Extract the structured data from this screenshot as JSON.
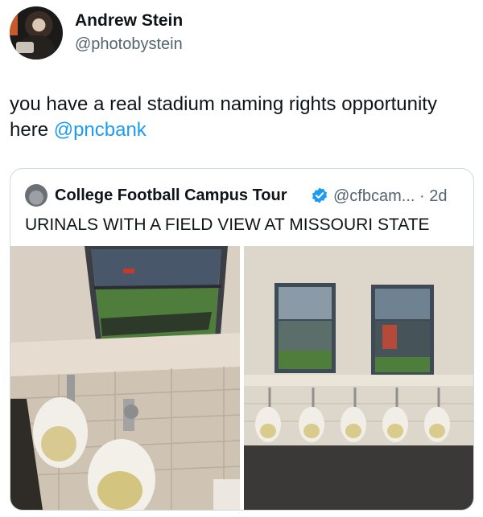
{
  "author": {
    "display_name": "Andrew Stein",
    "handle": "@photobystein"
  },
  "tweet": {
    "text": "you have a real stadium naming rights opportunity here ",
    "mention": "@pncbank"
  },
  "quote": {
    "display_name": "College Football Campus Tour",
    "verified_icon": "verified-badge-icon",
    "meta": "@cfbcam... · 2d",
    "text": "URINALS WITH A FIELD VIEW AT MISSOURI STATE",
    "images": [
      "urinal-field-window-photo-1",
      "urinal-field-window-photo-2"
    ]
  },
  "colors": {
    "link": "#1d9bf0",
    "secondary_text": "#536471",
    "border": "#cfd9de"
  }
}
